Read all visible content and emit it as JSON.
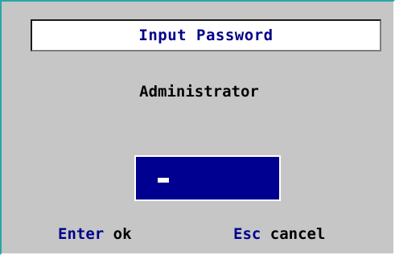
{
  "dialog": {
    "title": "Input Password",
    "user": "Administrator",
    "hints": {
      "enter_key": "Enter",
      "enter_action": "ok",
      "esc_key": "Esc",
      "esc_action": "cancel"
    }
  },
  "colors": {
    "background": "#c6c6c6",
    "title_text": "#00008b",
    "input_background": "#000090",
    "key_text": "#00008b",
    "outer_border": "#2aa6a6"
  }
}
